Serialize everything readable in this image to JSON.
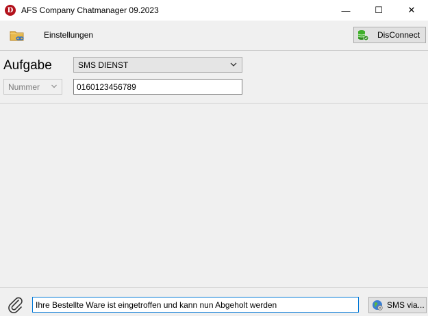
{
  "window": {
    "app_icon_letter": "D",
    "title": "AFS Company Chatmanager 09.2023",
    "minimize_glyph": "—",
    "maximize_glyph": "☐",
    "close_glyph": "✕"
  },
  "toolbar": {
    "folder_icon": "folder-link-icon",
    "settings_label": "Einstellungen",
    "disconnect_label": "DisConnect",
    "disconnect_icon": "database-connected-icon"
  },
  "form": {
    "aufgabe_label": "Aufgabe",
    "task_selected": "SMS DIENST",
    "number_type_selected": "Nummer",
    "number_value": "0160123456789"
  },
  "composer": {
    "attach_icon": "paperclip-icon",
    "message_value": "Ihre Bestellte Ware ist eingetroffen und kann nun Abgeholt werden",
    "send_label": "SMS via...",
    "send_icon": "globe-icon"
  },
  "colors": {
    "accent": "#0078d7",
    "app_icon": "#b3121c",
    "db_icon": "#3fae2a"
  }
}
